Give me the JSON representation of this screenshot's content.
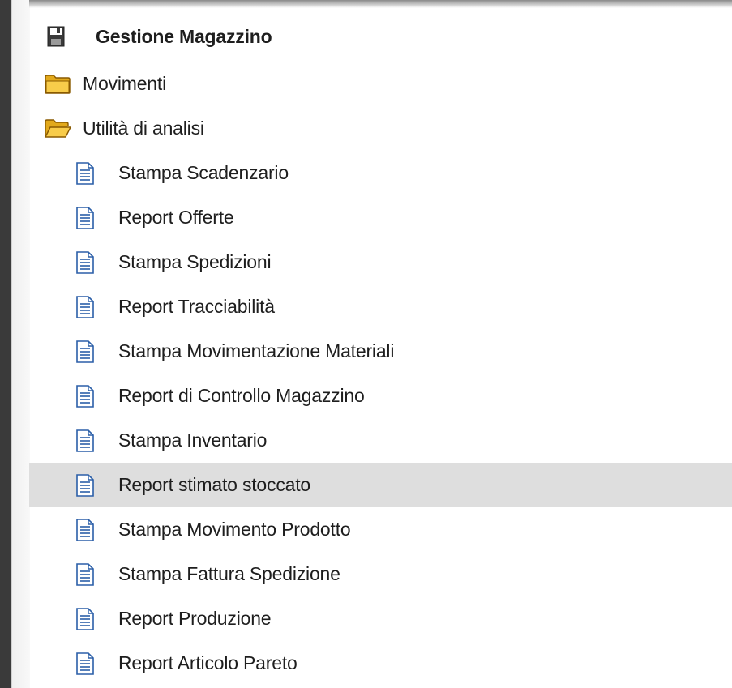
{
  "tree": {
    "root": {
      "label": "Gestione Magazzino",
      "icon": "floppy-disk-icon"
    },
    "folders": [
      {
        "label": "Movimenti",
        "icon": "folder-closed-icon"
      },
      {
        "label": "Utilità di analisi",
        "icon": "folder-open-icon"
      }
    ],
    "items": [
      {
        "label": "Stampa Scadenzario"
      },
      {
        "label": "Report Offerte"
      },
      {
        "label": "Stampa Spedizioni"
      },
      {
        "label": "Report Tracciabilità"
      },
      {
        "label": "Stampa Movimentazione Materiali"
      },
      {
        "label": "Report di Controllo Magazzino"
      },
      {
        "label": "Stampa Inventario"
      },
      {
        "label": "Report stimato stoccato"
      },
      {
        "label": "Stampa Movimento Prodotto"
      },
      {
        "label": "Stampa Fattura Spedizione"
      },
      {
        "label": "Report Produzione"
      },
      {
        "label": "Report Articolo Pareto"
      }
    ],
    "item_icon": "document-icon",
    "selected_item": "Report stimato stoccato"
  },
  "colors": {
    "selection": "#dedede",
    "folder": "#f5c242",
    "document_lines": "#2b5fa8"
  }
}
